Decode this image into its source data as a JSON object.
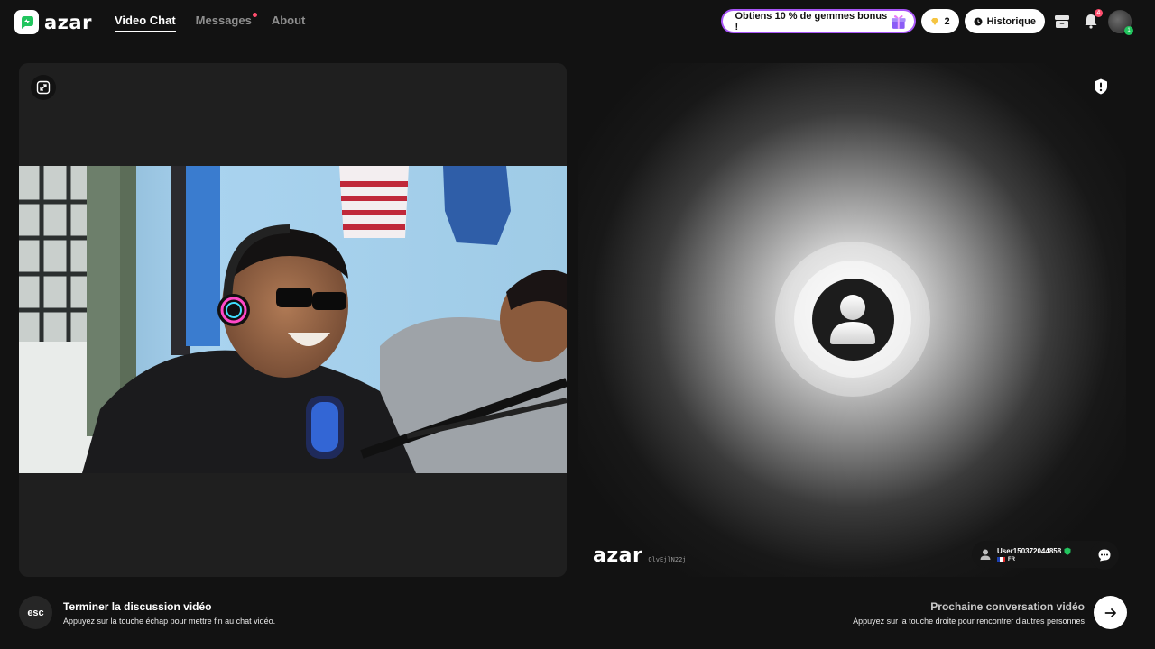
{
  "app": {
    "brand": "azar"
  },
  "nav": {
    "items": [
      {
        "label": "Video Chat",
        "active": true
      },
      {
        "label": "Messages",
        "has_dot": true
      },
      {
        "label": "About"
      }
    ]
  },
  "header": {
    "promo_label": "Obtiens 10 % de gemmes bonus !",
    "gems_count": "2",
    "history_label": "Historique",
    "notifications_count": "4",
    "avatar_badge": "1"
  },
  "remote": {
    "watermark_brand": "azar",
    "watermark_id": "OlvEjlN22j",
    "user_name": "User150372044858",
    "user_country": "FR"
  },
  "footer": {
    "esc_key": "esc",
    "end_title": "Terminer la discussion vidéo",
    "end_subtitle": "Appuyez sur la touche échap pour mettre fin au chat vidéo.",
    "next_title": "Prochaine conversation vidéo",
    "next_subtitle": "Appuyez sur la touche droite pour rencontrer d'autres personnes"
  },
  "colors": {
    "accent_green": "#22c55e",
    "promo_border": "#a855f7",
    "notification_red": "#ff4d6d",
    "background": "#121212"
  }
}
